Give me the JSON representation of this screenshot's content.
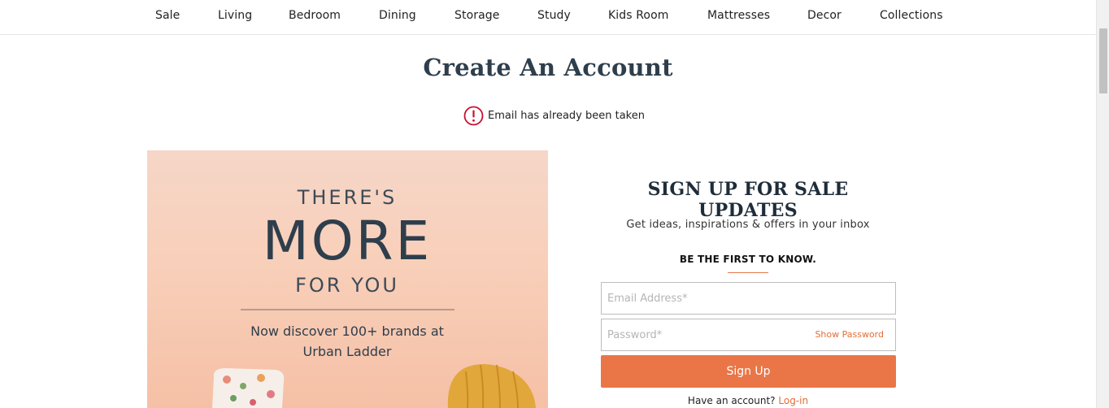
{
  "nav": {
    "items": [
      "Sale",
      "Living",
      "Bedroom",
      "Dining",
      "Storage",
      "Study",
      "Kids Room",
      "Mattresses",
      "Decor",
      "Collections"
    ]
  },
  "page": {
    "title": "Create An Account",
    "error_message": "Email has already been taken"
  },
  "promo": {
    "line1": "THERE'S",
    "line2": "MORE",
    "line3": "FOR YOU",
    "line4": "Now discover 100+ brands at",
    "line5": "Urban Ladder"
  },
  "signup": {
    "title": "SIGN UP FOR SALE UPDATES",
    "subtitle": "Get ideas, inspirations & offers in your inbox",
    "first_to_know": "BE THE FIRST TO KNOW.",
    "email_placeholder": "Email Address*",
    "email_value": "",
    "password_placeholder": "Password*",
    "password_value": "",
    "show_password": "Show Password",
    "button": "Sign Up",
    "have_account": "Have an account?",
    "login": "Log-in"
  },
  "icons": {
    "error": "error-exclamation-icon"
  },
  "colors": {
    "accent": "#ea7647",
    "link": "#e46d35",
    "title": "#2e3e4c",
    "error": "#c8102e"
  }
}
